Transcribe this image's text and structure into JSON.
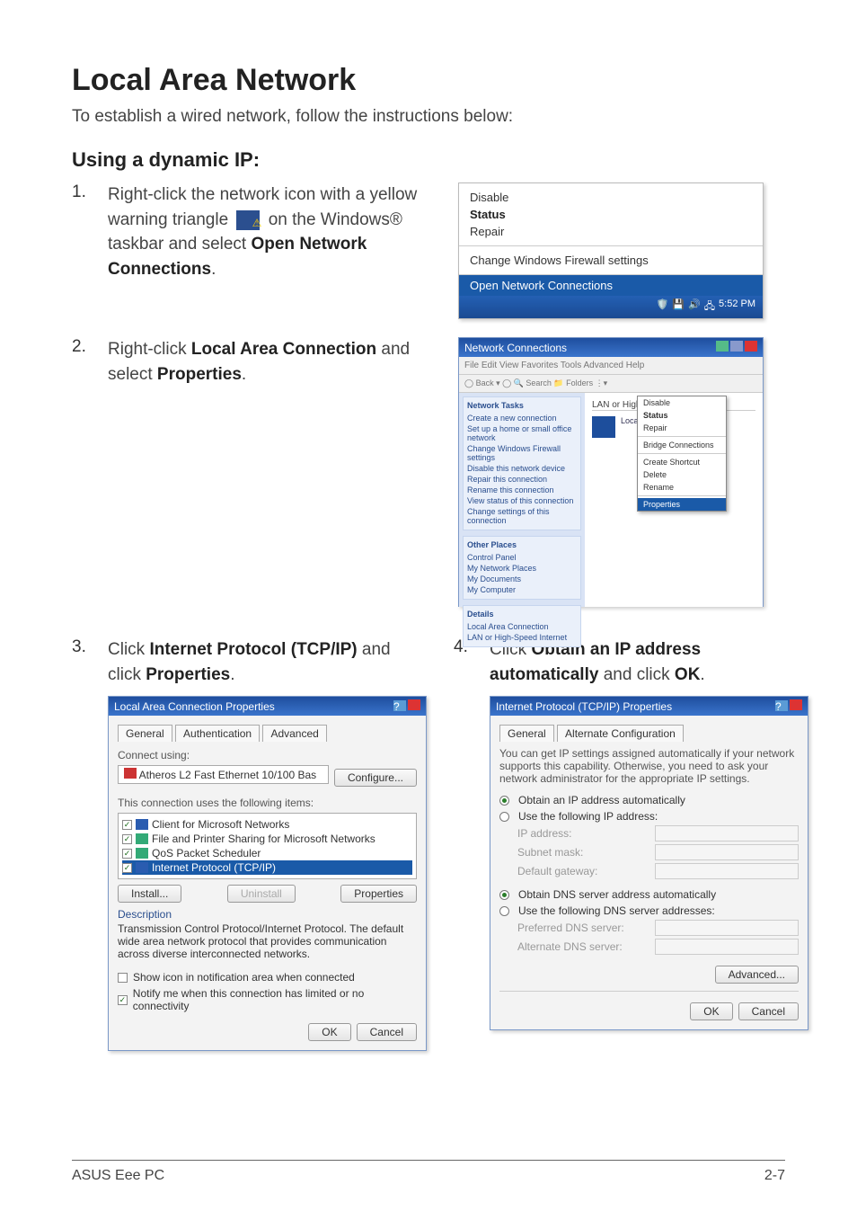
{
  "header": {
    "title": "Local Area Network"
  },
  "intro": "To establish a wired network, follow the instructions below:",
  "section1": {
    "title": "Using a dynamic IP:"
  },
  "steps": [
    {
      "num": "1.",
      "parts": [
        "Right-click the network icon with a yellow warning triangle ",
        " on the Windows® taskbar and select ",
        "."
      ],
      "bold": "Open Network Connections"
    },
    {
      "num": "2.",
      "pre": "Right-click ",
      "b1": "Local Area Connection",
      "mid": " and select ",
      "b2": "Properties",
      "post": "."
    },
    {
      "num": "3.",
      "pre": "Click ",
      "b1": "Internet Protocol (TCP/IP)",
      "mid": " and click ",
      "b2": "Properties",
      "post": "."
    },
    {
      "num": "4.",
      "pre": "Click ",
      "b1": "Obtain an IP address automatically",
      "mid": " and click ",
      "b2": "OK",
      "post": "."
    }
  ],
  "ctx_menu": {
    "items": [
      "Disable",
      "Status",
      "Repair"
    ],
    "group2": "Change Windows Firewall settings",
    "selected": "Open Network Connections",
    "clock": "5:52 PM"
  },
  "ncwin": {
    "title": "Network Connections",
    "toolbar": "File   Edit   View   Favorites   Tools   Advanced   Help",
    "side": {
      "boxes": [
        {
          "head": "Network Tasks",
          "rows": [
            "Create a new connection",
            "Set up a home or small office network",
            "Change Windows Firewall settings",
            "Disable this network device",
            "Repair this connection",
            "Rename this connection",
            "View status of this connection",
            "Change settings of this connection"
          ]
        },
        {
          "head": "Other Places",
          "rows": [
            "Control Panel",
            "My Network Places",
            "My Documents",
            "My Computer"
          ]
        },
        {
          "head": "Details",
          "rows": [
            "Local Area Connection",
            "LAN or High-Speed Internet"
          ]
        }
      ]
    },
    "section_label": "LAN or High-Speed Internet",
    "item_name": "Local Area Connection",
    "ctx": [
      "Disable",
      "Status",
      "Repair",
      "",
      "Bridge Connections",
      "",
      "Create Shortcut",
      "Delete",
      "Rename",
      ""
    ],
    "ctx_sel": "Properties"
  },
  "lacp": {
    "title": "Local Area Connection Properties",
    "tabs": [
      "General",
      "Authentication",
      "Advanced"
    ],
    "connect_label": "Connect using:",
    "adapter": "Atheros L2 Fast Ethernet 10/100 Bas",
    "configure_btn": "Configure...",
    "uses_label": "This connection uses the following items:",
    "items": [
      "Client for Microsoft Networks",
      "File and Printer Sharing for Microsoft Networks",
      "QoS Packet Scheduler",
      "Internet Protocol (TCP/IP)"
    ],
    "install_btn": "Install...",
    "uninstall_btn": "Uninstall",
    "properties_btn": "Properties",
    "desc_head": "Description",
    "desc_body": "Transmission Control Protocol/Internet Protocol. The default wide area network protocol that provides communication across diverse interconnected networks.",
    "notify1": "Show icon in notification area when connected",
    "notify2": "Notify me when this connection has limited or no connectivity",
    "ok": "OK",
    "cancel": "Cancel"
  },
  "ipprops": {
    "title": "Internet Protocol (TCP/IP) Properties",
    "tabs": [
      "General",
      "Alternate Configuration"
    ],
    "info": "You can get IP settings assigned automatically if your network supports this capability. Otherwise, you need to ask your network administrator for the appropriate IP settings.",
    "radio1": "Obtain an IP address automatically",
    "radio2": "Use the following IP address:",
    "ip_labels": [
      "IP address:",
      "Subnet mask:",
      "Default gateway:"
    ],
    "radio3": "Obtain DNS server address automatically",
    "radio4": "Use the following DNS server addresses:",
    "dns_labels": [
      "Preferred DNS server:",
      "Alternate DNS server:"
    ],
    "advanced_btn": "Advanced...",
    "ok": "OK",
    "cancel": "Cancel"
  },
  "footer": {
    "left": "ASUS Eee PC",
    "right": "2-7"
  }
}
